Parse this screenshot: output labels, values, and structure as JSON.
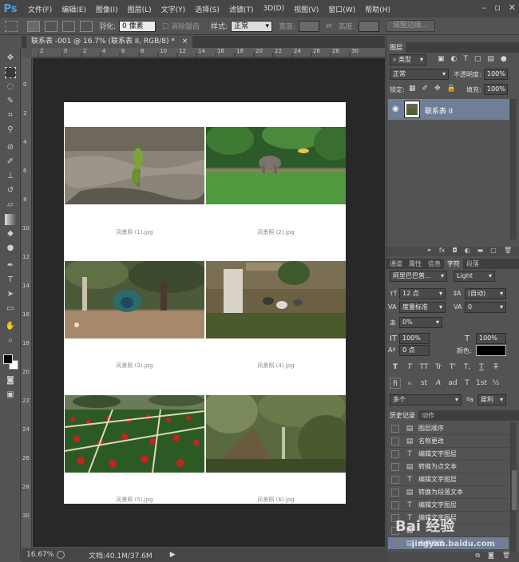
{
  "app": {
    "logo": "Ps"
  },
  "menu": [
    "文件(F)",
    "编辑(E)",
    "图像(I)",
    "图层(L)",
    "文字(Y)",
    "选择(S)",
    "滤镜(T)",
    "3D(D)",
    "视图(V)",
    "窗口(W)",
    "帮助(H)"
  ],
  "window_controls": {
    "minimize": "–",
    "restore": "▫",
    "close": "✕"
  },
  "options": {
    "feather_label": "羽化:",
    "feather_value": "0 像素",
    "antialias_label": "消除锯齿",
    "style_label": "样式:",
    "style_value": "正常",
    "width_label": "宽度:",
    "height_label": "高度:",
    "refine_button": "调整边缘..."
  },
  "document": {
    "tab_title": "联系表 -001 @ 16.7% (联系表 II, RGB/8) *",
    "tab_close": "×",
    "captions": [
      "风景照 (1).jpg",
      "风景照 (2).jpg",
      "风景照 (3).jpg",
      "风景照 (4).jpg",
      "风景照 (5).jpg",
      "风景照 (6).jpg"
    ]
  },
  "ruler": {
    "h_ticks": [
      "2",
      "0",
      "2",
      "4",
      "6",
      "8",
      "10",
      "12",
      "14",
      "16",
      "18",
      "20",
      "22",
      "24",
      "26",
      "28",
      "30"
    ],
    "v_ticks": [
      "0",
      "2",
      "4",
      "6",
      "8",
      "10",
      "12",
      "14",
      "16",
      "18",
      "20",
      "22",
      "24",
      "26",
      "28",
      "30"
    ]
  },
  "status": {
    "zoom": "16.67%",
    "doc_info": "文档:40.1M/37.6M"
  },
  "layers_panel": {
    "tab": "图层",
    "filter_kind": "类型",
    "blend_mode": "正常",
    "opacity_label": "不透明度:",
    "opacity_value": "100%",
    "lock_label": "锁定:",
    "fill_label": "填充:",
    "fill_value": "100%",
    "layer_name": "联系表 II"
  },
  "character_panel": {
    "tabs": [
      "通道",
      "属性",
      "信息",
      "字符",
      "段落"
    ],
    "active_tab": "字符",
    "font_family": "阿里巴巴普...",
    "font_style": "Light",
    "font_size": "12 点",
    "leading": "(自动)",
    "kerning": "度量标准",
    "tracking": "0",
    "vertical_scale_pct": "0%",
    "hscale": "100%",
    "vscale": "100%",
    "baseline": "0 点",
    "color_label": "颜色:",
    "language": "多个",
    "antialias": "犀利",
    "aa_label": "ªa",
    "style_buttons": [
      "T",
      "T",
      "TT",
      "Tr",
      "T'",
      "T,",
      "T",
      "T"
    ],
    "opentype_buttons": [
      "fi",
      "ℴ",
      "st",
      "A",
      "ad",
      "T",
      "1st",
      "½"
    ]
  },
  "history_panel": {
    "tabs": [
      "历史记录",
      "动作"
    ],
    "active_tab": "历史记录",
    "items": [
      {
        "icon": "▤",
        "label": "图层顺序"
      },
      {
        "icon": "▤",
        "label": "名称更改"
      },
      {
        "icon": "T",
        "label": "编辑文字图层"
      },
      {
        "icon": "▤",
        "label": "转换为点文本"
      },
      {
        "icon": "T",
        "label": "编辑文字图层"
      },
      {
        "icon": "▤",
        "label": "转换为段落文本"
      },
      {
        "icon": "T",
        "label": "编辑文字图层"
      },
      {
        "icon": "T",
        "label": "编辑文字图层"
      },
      {
        "icon": "▤",
        "label": ""
      },
      {
        "icon": "▤",
        "label": "合并图层"
      }
    ]
  },
  "watermark": {
    "main": "Bai 经验",
    "url": "jingyan.baidu.com"
  }
}
